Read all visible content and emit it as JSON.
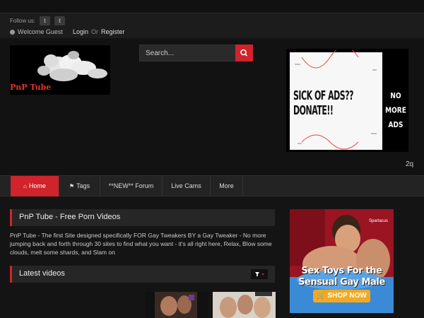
{
  "topbar": {
    "follow_label": "Follow us:",
    "social": [
      {
        "icon": "twitter-icon",
        "glyph": "t"
      },
      {
        "icon": "tumblr-icon",
        "glyph": "t"
      }
    ],
    "welcome": "Welcome Guest",
    "login": "Login",
    "or": "Or",
    "register": "Register"
  },
  "header": {
    "logo_text": "PnP Tube",
    "search_placeholder": "Search...",
    "ad": {
      "headline": "SICK OF ADS?? DONATE!!",
      "side_line1": "NO MORE",
      "side_line2": "ADS"
    },
    "tag": "2q"
  },
  "nav": {
    "items": [
      {
        "label": "Home",
        "icon": "home-icon",
        "active": true
      },
      {
        "label": "Tags",
        "icon": "tag-icon",
        "active": false
      },
      {
        "label": "**NEW** Forum",
        "icon": "",
        "active": false
      },
      {
        "label": "Live Cams",
        "icon": "",
        "active": false
      },
      {
        "label": "More",
        "icon": "",
        "active": false
      }
    ]
  },
  "main": {
    "title": "PnP Tube - Free Porn Videos",
    "description": "PnP Tube - The first Site designed specifically FOR Gay Tweakers BY a Gay Tweaker - No more jumping back and forth through 30 sites to find what you want - it's all right here, Relax, Blow some clouds, melt some shards, and Slam on",
    "latest_title": "Latest videos"
  },
  "side_ad": {
    "brand": "Spartacus",
    "line1": "Sex Toys For the",
    "line2": "Sensual Gay Male",
    "shop": "SHOP NOW"
  },
  "colors": {
    "accent": "#d0232b",
    "background": "#111111",
    "panel": "#262626"
  }
}
